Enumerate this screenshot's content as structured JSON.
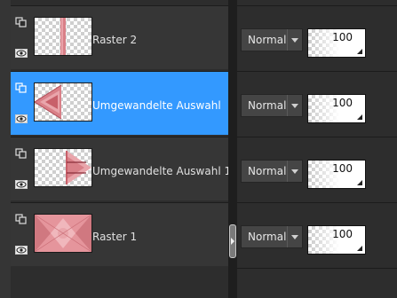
{
  "layers": [
    {
      "name": "Raster 2",
      "selected": false,
      "thumbnail": "vertical-pink-stripe",
      "blend_mode": "Normal",
      "opacity": "100"
    },
    {
      "name": "Umgewandelte Auswahl",
      "selected": true,
      "thumbnail": "pink-pattern-left",
      "blend_mode": "Normal",
      "opacity": "100"
    },
    {
      "name": "Umgewandelte Auswahl 1",
      "selected": false,
      "thumbnail": "pink-arrow-right",
      "blend_mode": "Normal",
      "opacity": "100"
    },
    {
      "name": "Raster 1",
      "selected": false,
      "thumbnail": "pink-kaleidoscope",
      "blend_mode": "Normal",
      "opacity": "100"
    }
  ],
  "colors": {
    "selection": "#3399ff",
    "panel": "#363636",
    "background": "#2d2d2d",
    "thumb_pink": "#d98088"
  },
  "icons": {
    "lock": "layer-link-icon",
    "visibility": "eye-icon",
    "dropdown": "chevron-down-icon"
  }
}
